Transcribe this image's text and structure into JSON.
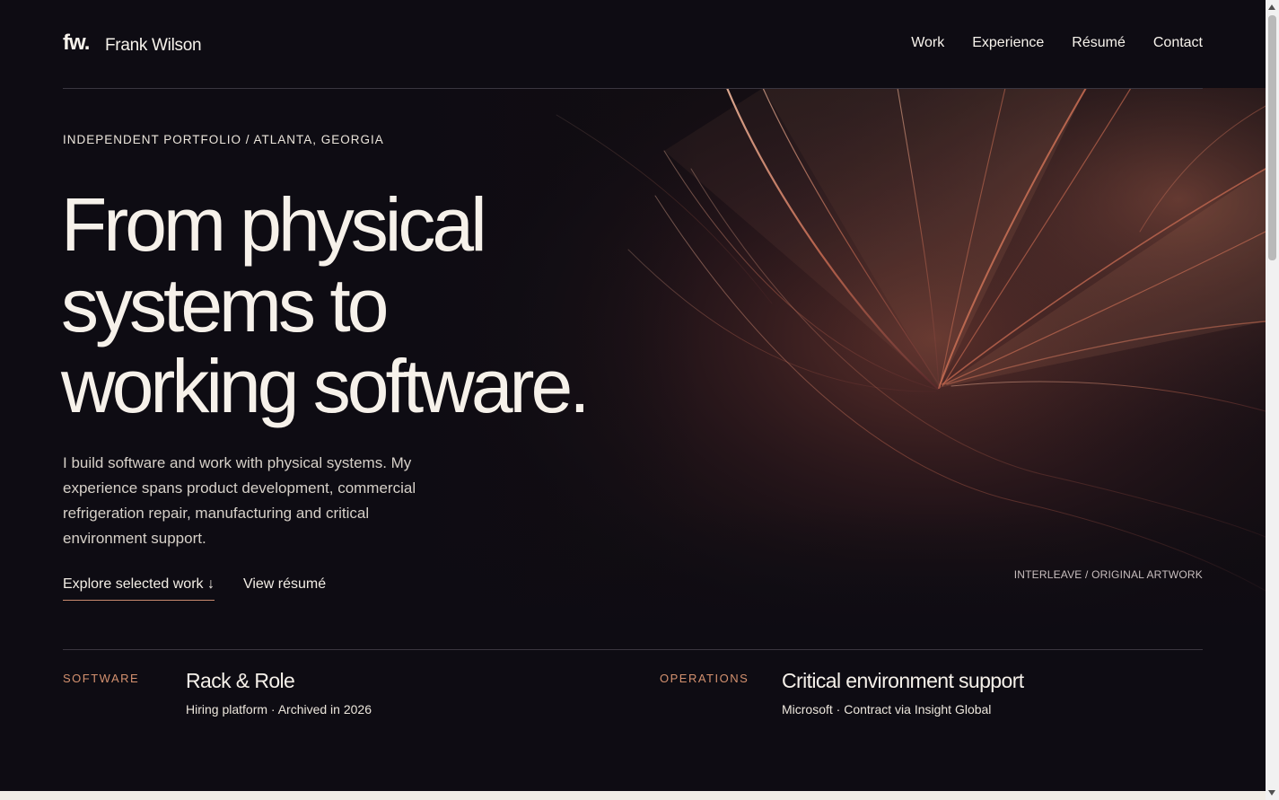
{
  "header": {
    "logo_mark": "fw.",
    "logo_name": "Frank Wilson",
    "nav": [
      "Work",
      "Experience",
      "Résumé",
      "Contact"
    ]
  },
  "hero": {
    "eyebrow": "INDEPENDENT PORTFOLIO / ATLANTA, GEORGIA",
    "headline_lines": [
      "From physical",
      "systems to",
      "working software."
    ],
    "intro": "I build software and work with physical systems. My experience spans product development, commercial refrigeration repair, manufacturing and critical environment support.",
    "cta_primary": "Explore selected work ↓",
    "cta_secondary": "View résumé",
    "art_caption": "INTERLEAVE / ORIGINAL ARTWORK"
  },
  "features": [
    {
      "tag": "SOFTWARE",
      "title": "Rack & Role",
      "meta": "Hiring platform · Archived in 2026"
    },
    {
      "tag": "OPERATIONS",
      "title": "Critical environment support",
      "meta": "Microsoft · Contract via Insight Global"
    }
  ],
  "colors": {
    "background": "#0e0c13",
    "accent": "#d4916f",
    "text": "#f6f1ea"
  }
}
